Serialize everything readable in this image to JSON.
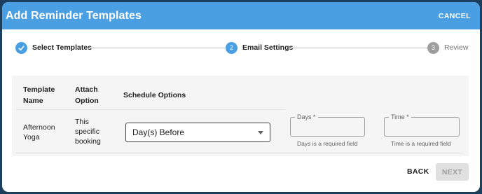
{
  "header": {
    "title": "Add Reminder Templates",
    "cancel_label": "CANCEL"
  },
  "stepper": {
    "steps": [
      {
        "number": "",
        "label": "Select Templates",
        "state": "completed"
      },
      {
        "number": "2",
        "label": "Email Settings",
        "state": "active"
      },
      {
        "number": "3",
        "label": "Review",
        "state": "pending"
      }
    ]
  },
  "table": {
    "headers": {
      "template_name": "Template Name",
      "attach_option": "Attach Option",
      "schedule_options": "Schedule Options"
    },
    "rows": [
      {
        "template_name": "Afternoon Yoga",
        "attach_option": "This specific booking",
        "schedule": {
          "selected": "Day(s) Before"
        },
        "days": {
          "label": "Days *",
          "value": "",
          "helper": "Days is a required field"
        },
        "time": {
          "label": "Time *",
          "value": "",
          "helper": "Time is a required field"
        }
      }
    ]
  },
  "footer": {
    "back_label": "BACK",
    "next_label": "NEXT"
  },
  "colors": {
    "primary": "#4a9fe3",
    "outer_frame": "#1d3f5e",
    "disabled_button": "#e0e0e0"
  }
}
